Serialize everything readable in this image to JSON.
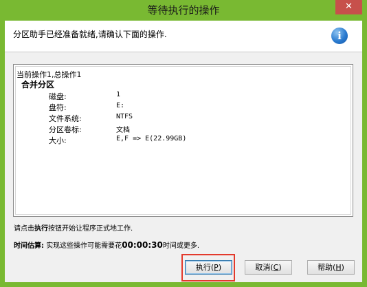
{
  "window": {
    "title": "等待执行的操作",
    "close_glyph": "✕"
  },
  "header": {
    "message": "分区助手已经准备就绪,请确认下面的操作.",
    "icon": "info-icon",
    "icon_glyph": "i"
  },
  "operations": {
    "summary": "当前操作1,总操作1",
    "title": "合并分区",
    "rows": [
      {
        "label": "磁盘:",
        "value": "1"
      },
      {
        "label": "盘符:",
        "value": "E:"
      },
      {
        "label": "文件系统:",
        "value": "NTFS"
      },
      {
        "label": "分区卷标:",
        "value": "文档"
      },
      {
        "label": "大小:",
        "value": "E,F => E(22.99GB)"
      }
    ]
  },
  "hint": {
    "prefix": "请点击",
    "bold": "执行",
    "suffix": "按钮开始让程序正式地工作."
  },
  "estimate": {
    "label": "时间估算:",
    "prefix": "实现这些操作可能需要花",
    "time": "00:00:30",
    "suffix": "时间或更多."
  },
  "buttons": {
    "execute": {
      "label": "执行(",
      "key": "P",
      "end": ")"
    },
    "cancel": {
      "label": "取消(",
      "key": "C",
      "end": ")"
    },
    "help": {
      "label": "帮助(",
      "key": "H",
      "end": ")"
    }
  },
  "colors": {
    "titlebar": "#79b932",
    "close": "#c7504b",
    "highlight": "#e33a2c"
  }
}
